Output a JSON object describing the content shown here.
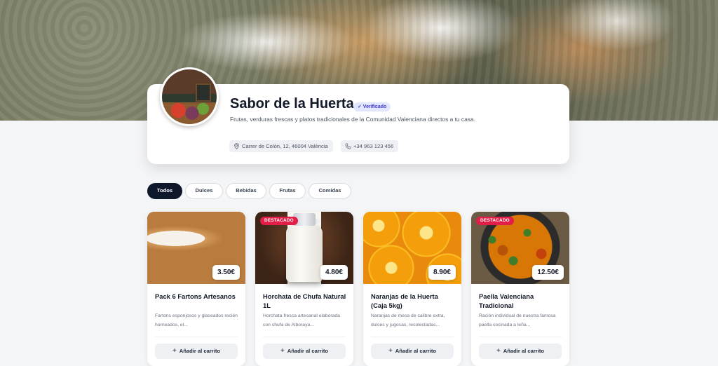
{
  "store": {
    "name": "Sabor de la Huerta",
    "verified_label": "✓ Verificado",
    "description": "Frutas, verduras frescas y platos tradicionales de la Comunidad Valenciana directos a tu casa.",
    "address": "Carrer de Colón, 12, 46004 València",
    "phone": "+34 963 123 456"
  },
  "filters": [
    {
      "label": "Todos",
      "active": true
    },
    {
      "label": "Dulces",
      "active": false
    },
    {
      "label": "Bebidas",
      "active": false
    },
    {
      "label": "Frutas",
      "active": false
    },
    {
      "label": "Comidas",
      "active": false
    }
  ],
  "featured_badge_label": "DESTACADO",
  "cart_label": "Añadir al carrito",
  "products": [
    {
      "title": "Pack 6 Fartons Artesanos",
      "description": "Fartons esponjosos y glaseados recién horneados, el...",
      "price": "3.50€",
      "featured": false
    },
    {
      "title": "Horchata de Chufa Natural 1L",
      "description": "Horchata fresca artesanal elaborada con chufa de Alboraya...",
      "price": "4.80€",
      "featured": true
    },
    {
      "title": "Naranjas de la Huerta (Caja 5kg)",
      "description": "Naranjas de mesa de calibre extra, dulces y jugosas, recolectadas...",
      "price": "8.90€",
      "featured": false
    },
    {
      "title": "Paella Valenciana Tradicional",
      "description": "Ración individual de nuestra famosa paella cocinada a leña...",
      "price": "12.50€",
      "featured": true
    }
  ],
  "colors": {
    "accent": "#0f172a",
    "badge": "#e11d48",
    "verified_bg": "#e0e7ff",
    "verified_text": "#4338ca"
  }
}
